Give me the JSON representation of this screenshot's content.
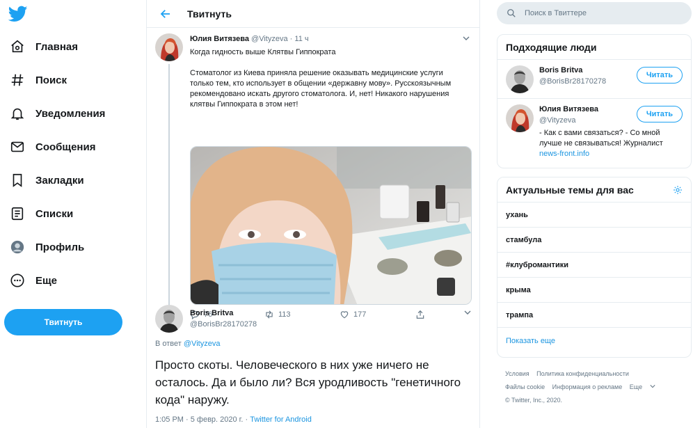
{
  "nav": {
    "items": [
      {
        "label": "Главная",
        "icon": "home-icon"
      },
      {
        "label": "Поиск",
        "icon": "hashtag-icon"
      },
      {
        "label": "Уведомления",
        "icon": "bell-icon"
      },
      {
        "label": "Сообщения",
        "icon": "mail-icon"
      },
      {
        "label": "Закладки",
        "icon": "bookmark-icon"
      },
      {
        "label": "Списки",
        "icon": "list-icon"
      },
      {
        "label": "Профиль",
        "icon": "profile-icon"
      },
      {
        "label": "Еще",
        "icon": "more-icon"
      }
    ],
    "tweet_button": "Твитнуть"
  },
  "header": {
    "title": "Твитнуть"
  },
  "tweet1": {
    "name": "Юлия Витязева",
    "handle": "@Vityzeva",
    "sep": "·",
    "time": "11 ч",
    "line1": "Когда гидность выше Клятвы Гиппократа",
    "body": "Стоматолог из Киева приняла решение оказывать медицинские услуги только тем, кто использует в общении «державну мову». Русскоязычным рекомендовано искать другого стоматолога. И, нет! Никакого нарушения клятвы Гиппократа в этом нет!",
    "replies": "76",
    "retweets": "113",
    "likes": "177"
  },
  "tweet2": {
    "name": "Boris Britva",
    "handle": "@BorisBr28170278",
    "reply_prefix": "В ответ",
    "reply_to": "@Vityzeva",
    "text": "Просто скоты. Человеческого в них уже ничего не осталось. Да и было ли? Вся уродливость \"генетичного кода\" наружу.",
    "timestamp": "1:05 PM · 5 февр. 2020 г. ·",
    "source": "Twitter for Android"
  },
  "search": {
    "placeholder": "Поиск в Твиттере"
  },
  "who_to_follow": {
    "title": "Подходящие люди",
    "users": [
      {
        "name": "Boris Britva",
        "handle": "@BorisBr28170278",
        "bio": "",
        "link": "",
        "button": "Читать"
      },
      {
        "name": "Юлия Витязева",
        "handle": "@Vityzeva",
        "bio": "- Как с вами связаться? - Со мной лучше не связываться! Журналист",
        "link": "news-front.info",
        "button": "Читать"
      }
    ]
  },
  "trends": {
    "title": "Актуальные темы для вас",
    "items": [
      "ухань",
      "стамбула",
      "#клубромантики",
      "крыма",
      "трампа"
    ],
    "show_more": "Показать еще"
  },
  "footer": {
    "links": [
      "Условия",
      "Политика конфиденциальности",
      "Файлы cookie",
      "Информация о рекламе",
      "Еще"
    ],
    "copyright": "© Twitter, Inc., 2020."
  },
  "colors": {
    "accent": "#1da1f2",
    "text": "#14171a",
    "muted": "#657786",
    "border": "#e6ecf0"
  }
}
